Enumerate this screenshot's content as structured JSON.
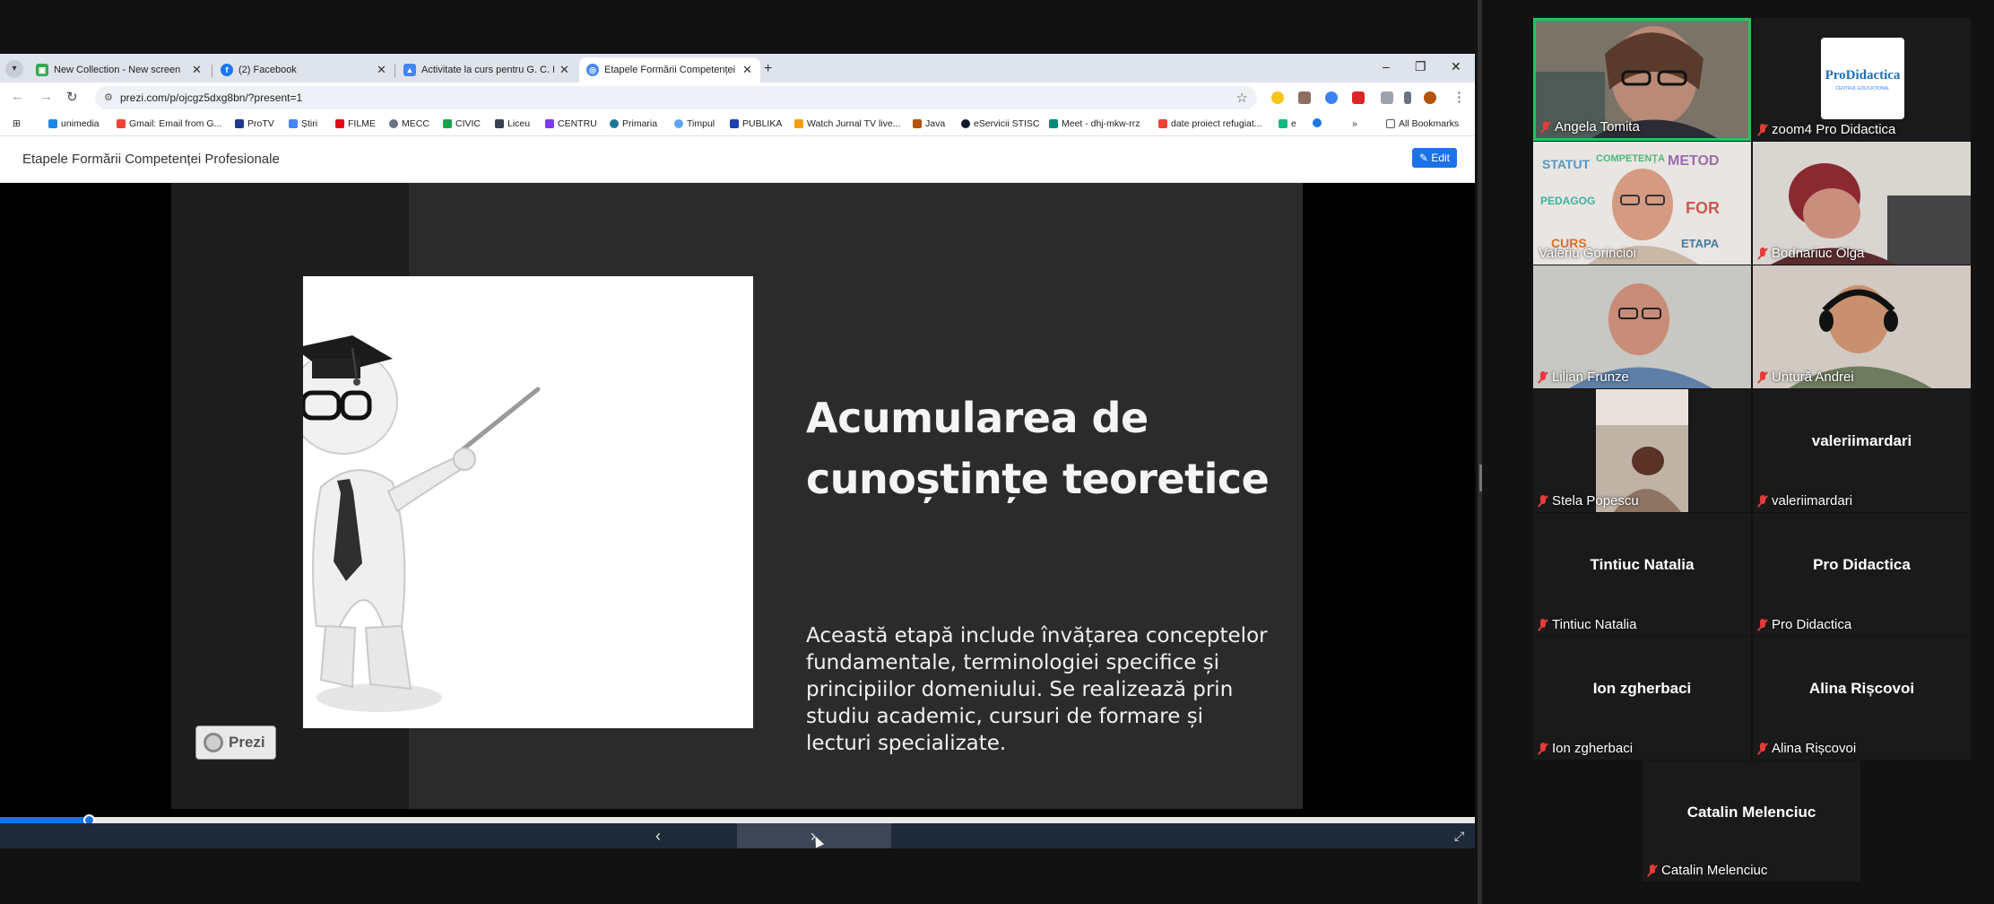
{
  "browser": {
    "tabs": [
      {
        "label": "New Collection - New screen",
        "color": "#34a853"
      },
      {
        "label": "(2) Facebook",
        "color": "#1877f2"
      },
      {
        "label": "Activitate la curs pentru G. C. N",
        "color": "#4285f4"
      },
      {
        "label": "Etapele Formării Competenței P",
        "color": "#4a89f3"
      }
    ],
    "new_tab": "+",
    "window_controls": {
      "minimize": "–",
      "restore": "❐",
      "close": "✕"
    },
    "url": "prezi.com/p/ojcgz5dxg8bn/?present=1",
    "bookmarks": [
      {
        "label": "unimedia",
        "color": "#1e88e5"
      },
      {
        "label": "Gmail: Email from G...",
        "color": "#ea4335"
      },
      {
        "label": "ProTV",
        "color": "#1e3a8a"
      },
      {
        "label": "Știri",
        "color": "#4285f4"
      },
      {
        "label": "FILME",
        "color": "#e50914"
      },
      {
        "label": "MECC",
        "color": "#6b7280"
      },
      {
        "label": "CIVIC",
        "color": "#16a34a"
      },
      {
        "label": "Liceu",
        "color": "#374151"
      },
      {
        "label": "CENTRU",
        "color": "#7c3aed"
      },
      {
        "label": "Primaria",
        "color": "#21759b"
      },
      {
        "label": "Timpul",
        "color": "#60a5fa"
      },
      {
        "label": "PUBLIKA",
        "color": "#1e40af"
      },
      {
        "label": "Watch Jurnal TV live...",
        "color": "#f59e0b"
      },
      {
        "label": "Java",
        "color": "#b45309"
      },
      {
        "label": "eServicii STISC",
        "color": "#111827"
      },
      {
        "label": "Meet - dhj-mkw-rrz",
        "color": "#00897b"
      },
      {
        "label": "date proiect refugiat...",
        "color": "#ea4335"
      },
      {
        "label": "e",
        "color": "#10b981"
      }
    ],
    "all_bookmarks": "All Bookmarks"
  },
  "prezi": {
    "title": "Etapele Formării Competenței Profesionale",
    "edit_label": "Edit",
    "slide_title": "Acumularea de cunoștințe teoretice",
    "slide_body": "Această etapă include învățarea conceptelor fundamentale, terminologiei specifice și principiilor domeniului. Se realizează prin studiu academic, cursuri de formare și lecturi specializate.",
    "logo_text": "Prezi",
    "progress": 0.06,
    "controls": {
      "prev": "‹",
      "next": "›",
      "fullscreen": "⤢"
    }
  },
  "meeting": {
    "participants": [
      {
        "name": "Angela Tomita",
        "video": true,
        "active": true
      },
      {
        "name": "zoom4 Pro Didactica",
        "video": true,
        "logo_text": "ProDidactica",
        "logo_sub": "CENTRUL EDUCAȚIONAL"
      },
      {
        "name": "Valeriu Gorincioi",
        "video": true
      },
      {
        "name": "Bodnariuc Olga",
        "video": true
      },
      {
        "name": "Lilian Frunze",
        "video": true
      },
      {
        "name": "Untură Andrei",
        "video": true
      },
      {
        "name": "Stela Popescu",
        "video": true
      },
      {
        "name": "valeriimardari",
        "video": false,
        "big_name": "valeriimardari"
      },
      {
        "name": "Tintiuc Natalia",
        "video": false,
        "big_name": "Tintiuc Natalia"
      },
      {
        "name": "Pro Didactica",
        "video": false,
        "big_name": "Pro Didactica"
      },
      {
        "name": "Ion zgherbaci",
        "video": false,
        "big_name": "Ion zgherbaci"
      },
      {
        "name": "Alina Rișcovoi",
        "video": false,
        "big_name": "Alina Rișcovoi"
      },
      {
        "name": "Catalin Melenciuc",
        "video": false,
        "big_name": "Catalin Melenciuc"
      }
    ]
  }
}
